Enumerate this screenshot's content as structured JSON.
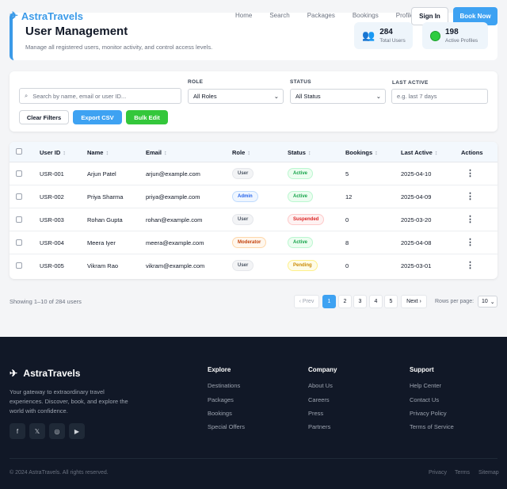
{
  "nav": {
    "brand": "AstraTravels",
    "links": [
      "Home",
      "Search",
      "Packages",
      "Bookings",
      "Profile"
    ],
    "signin": "Sign In",
    "book": "Book Now"
  },
  "header": {
    "title": "User Management",
    "subtitle": "Manage all registered users, monitor activity, and control access levels.",
    "stats": [
      {
        "value": "284",
        "label": "Total Users",
        "icon": "users-icon"
      },
      {
        "value": "198",
        "label": "Active Profiles",
        "icon": "green-dot-icon"
      }
    ]
  },
  "filters": {
    "search_placeholder": "Search by name, email or user ID...",
    "role_label": "ROLE",
    "role_value": "All Roles",
    "status_label": "STATUS",
    "status_value": "All Status",
    "last_active_label": "LAST ACTIVE",
    "last_active_placeholder": "e.g. last 7 days",
    "clear": "Clear Filters",
    "export": "Export CSV",
    "bulk": "Bulk Edit"
  },
  "table": {
    "headers": [
      "User ID",
      "Name",
      "Email",
      "Role",
      "Status",
      "Bookings",
      "Last Active",
      "Actions"
    ],
    "rows": [
      {
        "id": "USR-001",
        "name": "Arjun Patel",
        "email": "arjun@example.com",
        "role": "User",
        "status": "Active",
        "bookings": "5",
        "last": "2025-04-10"
      },
      {
        "id": "USR-002",
        "name": "Priya Sharma",
        "email": "priya@example.com",
        "role": "Admin",
        "status": "Active",
        "bookings": "12",
        "last": "2025-04-09"
      },
      {
        "id": "USR-003",
        "name": "Rohan Gupta",
        "email": "rohan@example.com",
        "role": "User",
        "status": "Suspended",
        "bookings": "0",
        "last": "2025-03-20"
      },
      {
        "id": "USR-004",
        "name": "Meera Iyer",
        "email": "meera@example.com",
        "role": "Moderator",
        "status": "Active",
        "bookings": "8",
        "last": "2025-04-08"
      },
      {
        "id": "USR-005",
        "name": "Vikram Rao",
        "email": "vikram@example.com",
        "role": "User",
        "status": "Pending",
        "bookings": "0",
        "last": "2025-03-01"
      }
    ]
  },
  "pagination": {
    "showing": "Showing 1–10 of 284 users",
    "prev": "‹ Prev",
    "pages": [
      "1",
      "2",
      "3",
      "4",
      "5"
    ],
    "next": "Next ›",
    "rows_label": "Rows per page:",
    "rows_value": "10"
  },
  "footer": {
    "brand": "AstraTravels",
    "tagline": "Your gateway to extraordinary travel experiences. Discover, book, and explore the world with confidence.",
    "social": [
      "f",
      "𝕏",
      "◎",
      "▶"
    ],
    "columns": [
      {
        "title": "Explore",
        "links": [
          "Destinations",
          "Packages",
          "Bookings",
          "Special Offers"
        ]
      },
      {
        "title": "Company",
        "links": [
          "About Us",
          "Careers",
          "Press",
          "Partners"
        ]
      },
      {
        "title": "Support",
        "links": [
          "Help Center",
          "Contact Us",
          "Privacy Policy",
          "Terms of Service"
        ]
      }
    ],
    "copyright": "© 2024 AstraTravels. All rights reserved.",
    "legal": [
      "Privacy",
      "Terms",
      "Sitemap"
    ]
  },
  "colors": {
    "accent": "#3ea2f2",
    "success": "#2ecc40",
    "footer_bg": "#111827"
  }
}
